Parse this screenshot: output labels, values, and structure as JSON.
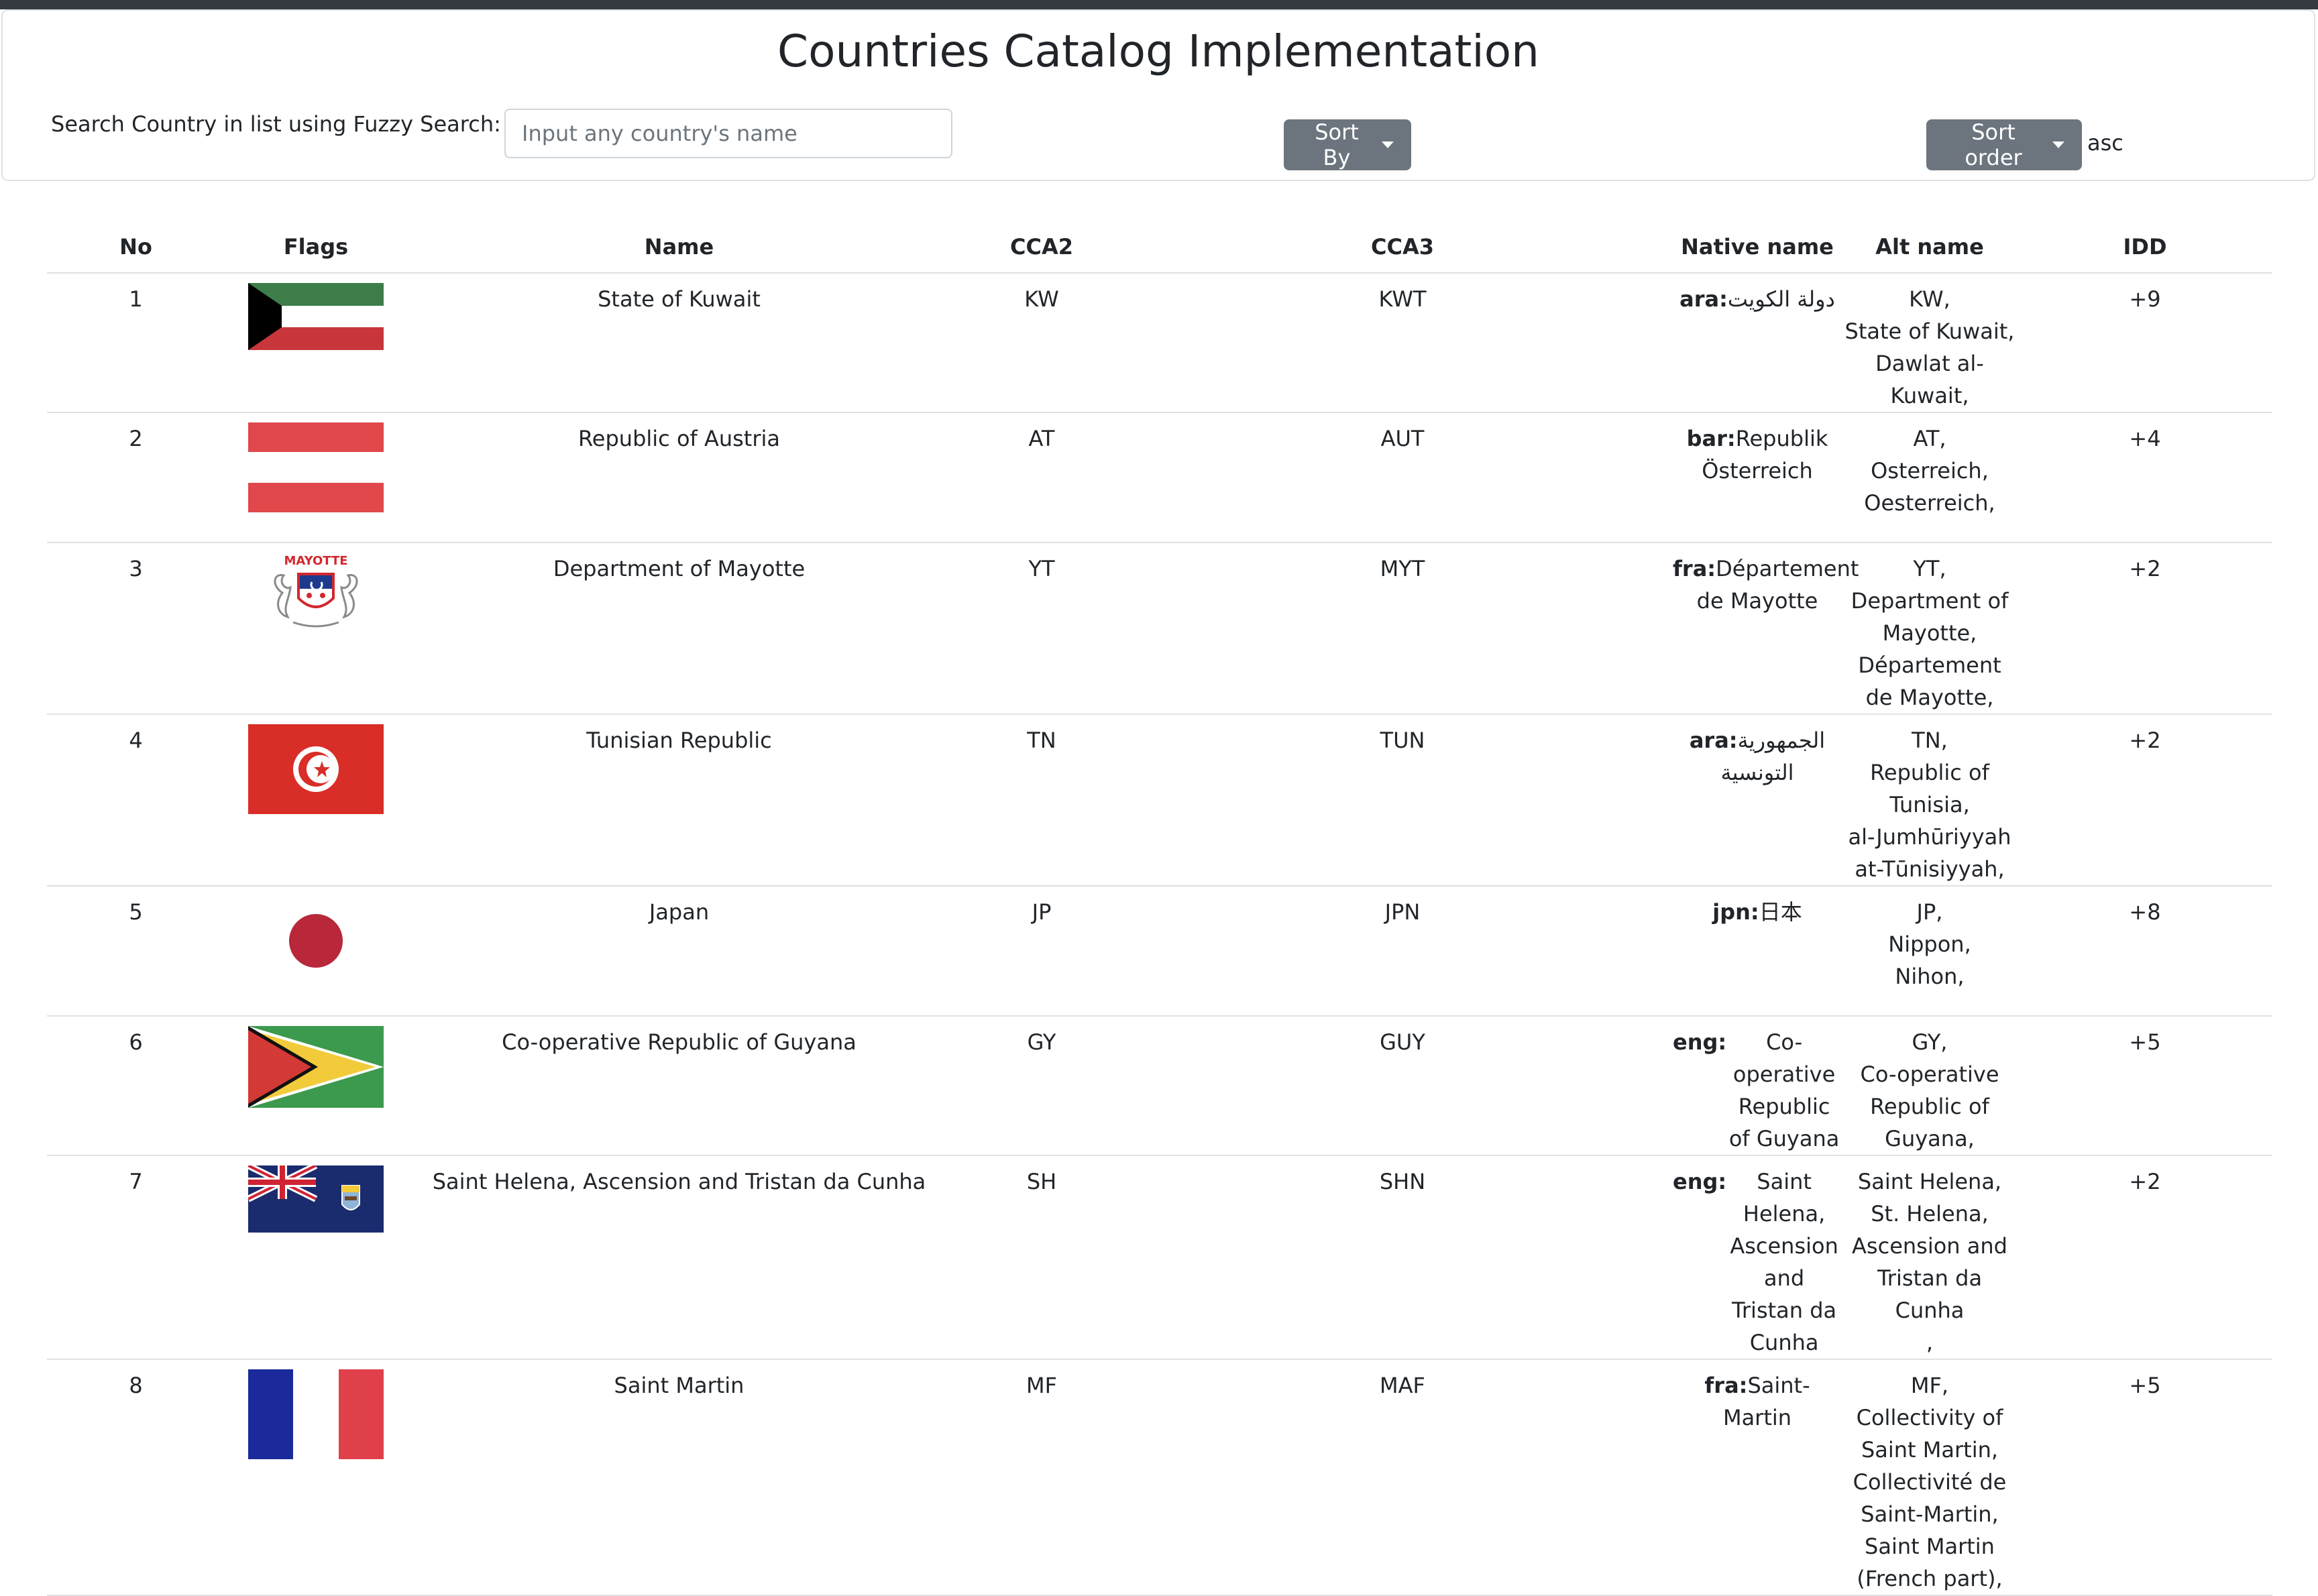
{
  "page": {
    "title": "Countries Catalog Implementation"
  },
  "search": {
    "label": "Search Country in list using Fuzzy Search:",
    "placeholder": "Input any country's name"
  },
  "sort": {
    "sort_by_label": "Sort By",
    "sort_order_label": "Sort order",
    "sort_order_value": "asc"
  },
  "colors": {
    "button_bg": "#6c757d",
    "border": "#dee2e6",
    "text": "#212529",
    "topbar": "#343a40"
  },
  "table": {
    "headers": {
      "no": "No",
      "flags": "Flags",
      "name": "Name",
      "cca2": "CCA2",
      "cca3": "CCA3",
      "native": "Native name",
      "alt": "Alt name",
      "idd": "IDD"
    },
    "rows": [
      {
        "no": "1",
        "flag": "kuwait-flag",
        "name": "State of Kuwait",
        "cca2": "KW",
        "cca3": "KWT",
        "native_lang": "ara:",
        "native_value": "دولة الكويت",
        "alt_names": [
          "KW,",
          "State of Kuwait,",
          "Dawlat al-Kuwait,"
        ],
        "idd": "+9"
      },
      {
        "no": "2",
        "flag": "austria-flag",
        "name": "Republic of Austria",
        "cca2": "AT",
        "cca3": "AUT",
        "native_lang": "bar:",
        "native_value": "Republik Österreich",
        "alt_names": [
          "AT,",
          "Osterreich,",
          "Oesterreich,"
        ],
        "idd": "+4"
      },
      {
        "no": "3",
        "flag": "mayotte-flag",
        "flag_text": "MAYOTTE",
        "name": "Department of Mayotte",
        "cca2": "YT",
        "cca3": "MYT",
        "native_lang": "fra:",
        "native_value": "Département de Mayotte",
        "alt_names": [
          "YT,",
          "Department of Mayotte,",
          "Département de Mayotte,"
        ],
        "idd": "+2"
      },
      {
        "no": "4",
        "flag": "tunisia-flag",
        "name": "Tunisian Republic",
        "cca2": "TN",
        "cca3": "TUN",
        "native_lang": "ara:",
        "native_value": "الجمهورية التونسية",
        "alt_names": [
          "TN,",
          "Republic of Tunisia,",
          "al-Jumhūriyyah at-Tūnisiyyah,"
        ],
        "idd": "+2"
      },
      {
        "no": "5",
        "flag": "japan-flag",
        "name": "Japan",
        "cca2": "JP",
        "cca3": "JPN",
        "native_lang": "jpn:",
        "native_value": "日本",
        "alt_names": [
          "JP,",
          "Nippon,",
          "Nihon,"
        ],
        "idd": "+8"
      },
      {
        "no": "6",
        "flag": "guyana-flag",
        "name": "Co-operative Republic of Guyana",
        "cca2": "GY",
        "cca3": "GUY",
        "native_lang": "eng:",
        "native_value": "Co-operative Republic of Guyana",
        "alt_names": [
          "GY,",
          "Co-operative Republic of Guyana,"
        ],
        "idd": "+5"
      },
      {
        "no": "7",
        "flag": "saint-helena-flag",
        "name": "Saint Helena, Ascension and Tristan da Cunha",
        "cca2": "SH",
        "cca3": "SHN",
        "native_lang": "eng:",
        "native_value": "Saint Helena, Ascension and Tristan da Cunha",
        "alt_names": [
          "Saint Helena,",
          "St. Helena, Ascension and Tristan da Cunha",
          ","
        ],
        "idd": "+2"
      },
      {
        "no": "8",
        "flag": "saint-martin-flag",
        "name": "Saint Martin",
        "cca2": "MF",
        "cca3": "MAF",
        "native_lang": "fra:",
        "native_value": "Saint-Martin",
        "alt_names": [
          "MF,",
          "Collectivity of Saint Martin,",
          "Collectivité de Saint-Martin,",
          "Saint Martin (French part),"
        ],
        "idd": "+5"
      }
    ]
  }
}
